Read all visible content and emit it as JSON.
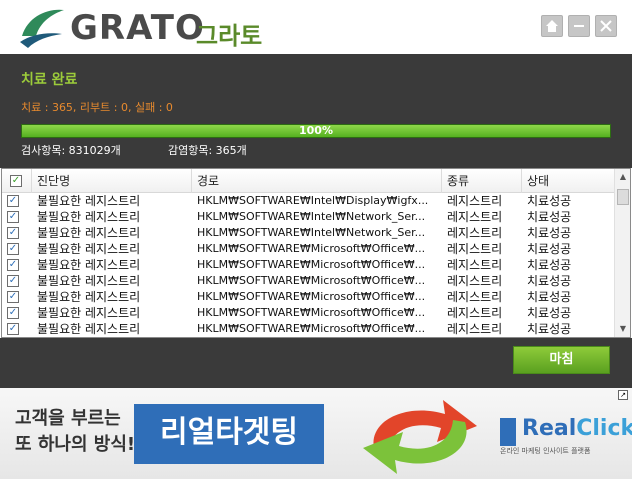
{
  "header": {
    "logo_text": "GRATO",
    "logo_kr": "그라토",
    "window_buttons": [
      "home-icon",
      "minimize-icon",
      "close-icon"
    ]
  },
  "status": {
    "title": "치료 완료",
    "counts": "치료 : 365, 리부트 : 0, 실패 : 0",
    "progress_percent": 100,
    "progress_label": "100%",
    "scan_items": "검사항목: 831029개",
    "infected_items": "감염항목: 365개"
  },
  "table": {
    "headers": {
      "name": "진단명",
      "path": "경로",
      "type": "종류",
      "status": "상태"
    },
    "rows": [
      {
        "checked": true,
        "name": "불필요한 레지스트리",
        "path": "HKLM₩SOFTWARE₩Intel₩Display₩igfx...",
        "type": "레지스트리",
        "status": "치료성공"
      },
      {
        "checked": true,
        "name": "불필요한 레지스트리",
        "path": "HKLM₩SOFTWARE₩Intel₩Network_Ser...",
        "type": "레지스트리",
        "status": "치료성공"
      },
      {
        "checked": true,
        "name": "불필요한 레지스트리",
        "path": "HKLM₩SOFTWARE₩Intel₩Network_Ser...",
        "type": "레지스트리",
        "status": "치료성공"
      },
      {
        "checked": true,
        "name": "불필요한 레지스트리",
        "path": "HKLM₩SOFTWARE₩Microsoft₩Office₩...",
        "type": "레지스트리",
        "status": "치료성공"
      },
      {
        "checked": true,
        "name": "불필요한 레지스트리",
        "path": "HKLM₩SOFTWARE₩Microsoft₩Office₩...",
        "type": "레지스트리",
        "status": "치료성공"
      },
      {
        "checked": true,
        "name": "불필요한 레지스트리",
        "path": "HKLM₩SOFTWARE₩Microsoft₩Office₩...",
        "type": "레지스트리",
        "status": "치료성공"
      },
      {
        "checked": true,
        "name": "불필요한 레지스트리",
        "path": "HKLM₩SOFTWARE₩Microsoft₩Office₩...",
        "type": "레지스트리",
        "status": "치료성공"
      },
      {
        "checked": true,
        "name": "불필요한 레지스트리",
        "path": "HKLM₩SOFTWARE₩Microsoft₩Office₩...",
        "type": "레지스트리",
        "status": "치료성공"
      },
      {
        "checked": true,
        "name": "불필요한 레지스트리",
        "path": "HKLM₩SOFTWARE₩Microsoft₩Office₩...",
        "type": "레지스트리",
        "status": "치료성공"
      }
    ]
  },
  "footer": {
    "finish_label": "마침"
  },
  "ad": {
    "line1": "고객을 부르는",
    "line2": "또 하나의 방식!",
    "brand": "리얼타겟팅",
    "logo_real": "Real",
    "logo_click": "Click",
    "logo_sub": "온라인 마케팅 인사이트 플랫폼"
  },
  "colors": {
    "accent_green": "#9ccc3a",
    "counts_orange": "#e78a2e",
    "panel_dark": "#3a3a3a",
    "ad_blue": "#2f6eb8"
  }
}
